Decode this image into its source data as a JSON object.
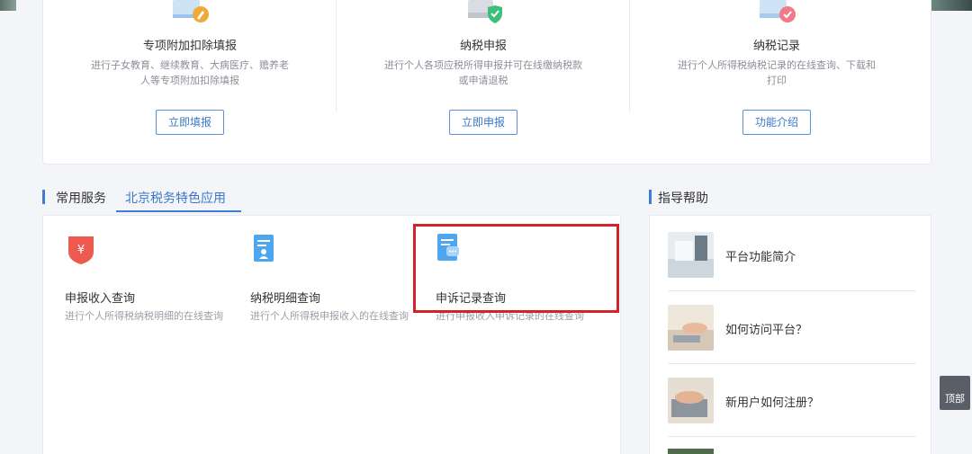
{
  "services": [
    {
      "title": "专项附加扣除填报",
      "desc": "进行子女教育、继续教育、大病医疗、赡养老人等专项附加扣除填报",
      "button": "立即填报",
      "icon": "pencil-document-icon",
      "badge_color": "#f0a93b"
    },
    {
      "title": "纳税申报",
      "desc": "进行个人各项应税所得申报并可在线缴纳税款或申请退税",
      "button": "立即申报",
      "icon": "shield-check-icon",
      "badge_color": "#3bbf7a"
    },
    {
      "title": "纳税记录",
      "desc": "进行个人所得税纳税记录的在线查询、下载和打印",
      "button": "功能介绍",
      "icon": "record-check-icon",
      "badge_color": "#f07a8a"
    }
  ],
  "section_left": {
    "tab1": "常用服务",
    "tab2": "北京税务特色应用"
  },
  "section_right": {
    "title": "指导帮助"
  },
  "tools": [
    {
      "title": "申报收入查询",
      "desc": "进行个人所得税纳税明细的在线查询",
      "icon": "yuan-shield-icon",
      "color": "#ee5a4f"
    },
    {
      "title": "纳税明细查询",
      "desc": "进行个人所得税申报收入的在线查询",
      "icon": "document-person-icon",
      "color": "#4ea7ee"
    },
    {
      "title": "申诉记录查询",
      "desc": "进行申报收入申诉记录的在线查询",
      "icon": "document-chat-icon",
      "color": "#4ea7ee"
    }
  ],
  "guides": [
    {
      "title": "平台功能简介"
    },
    {
      "title": "如何访问平台？"
    },
    {
      "title": "新用户如何注册？"
    }
  ],
  "back_top": "顶部",
  "accent_color": "#3b78c9",
  "highlight_color": "#d2222a"
}
